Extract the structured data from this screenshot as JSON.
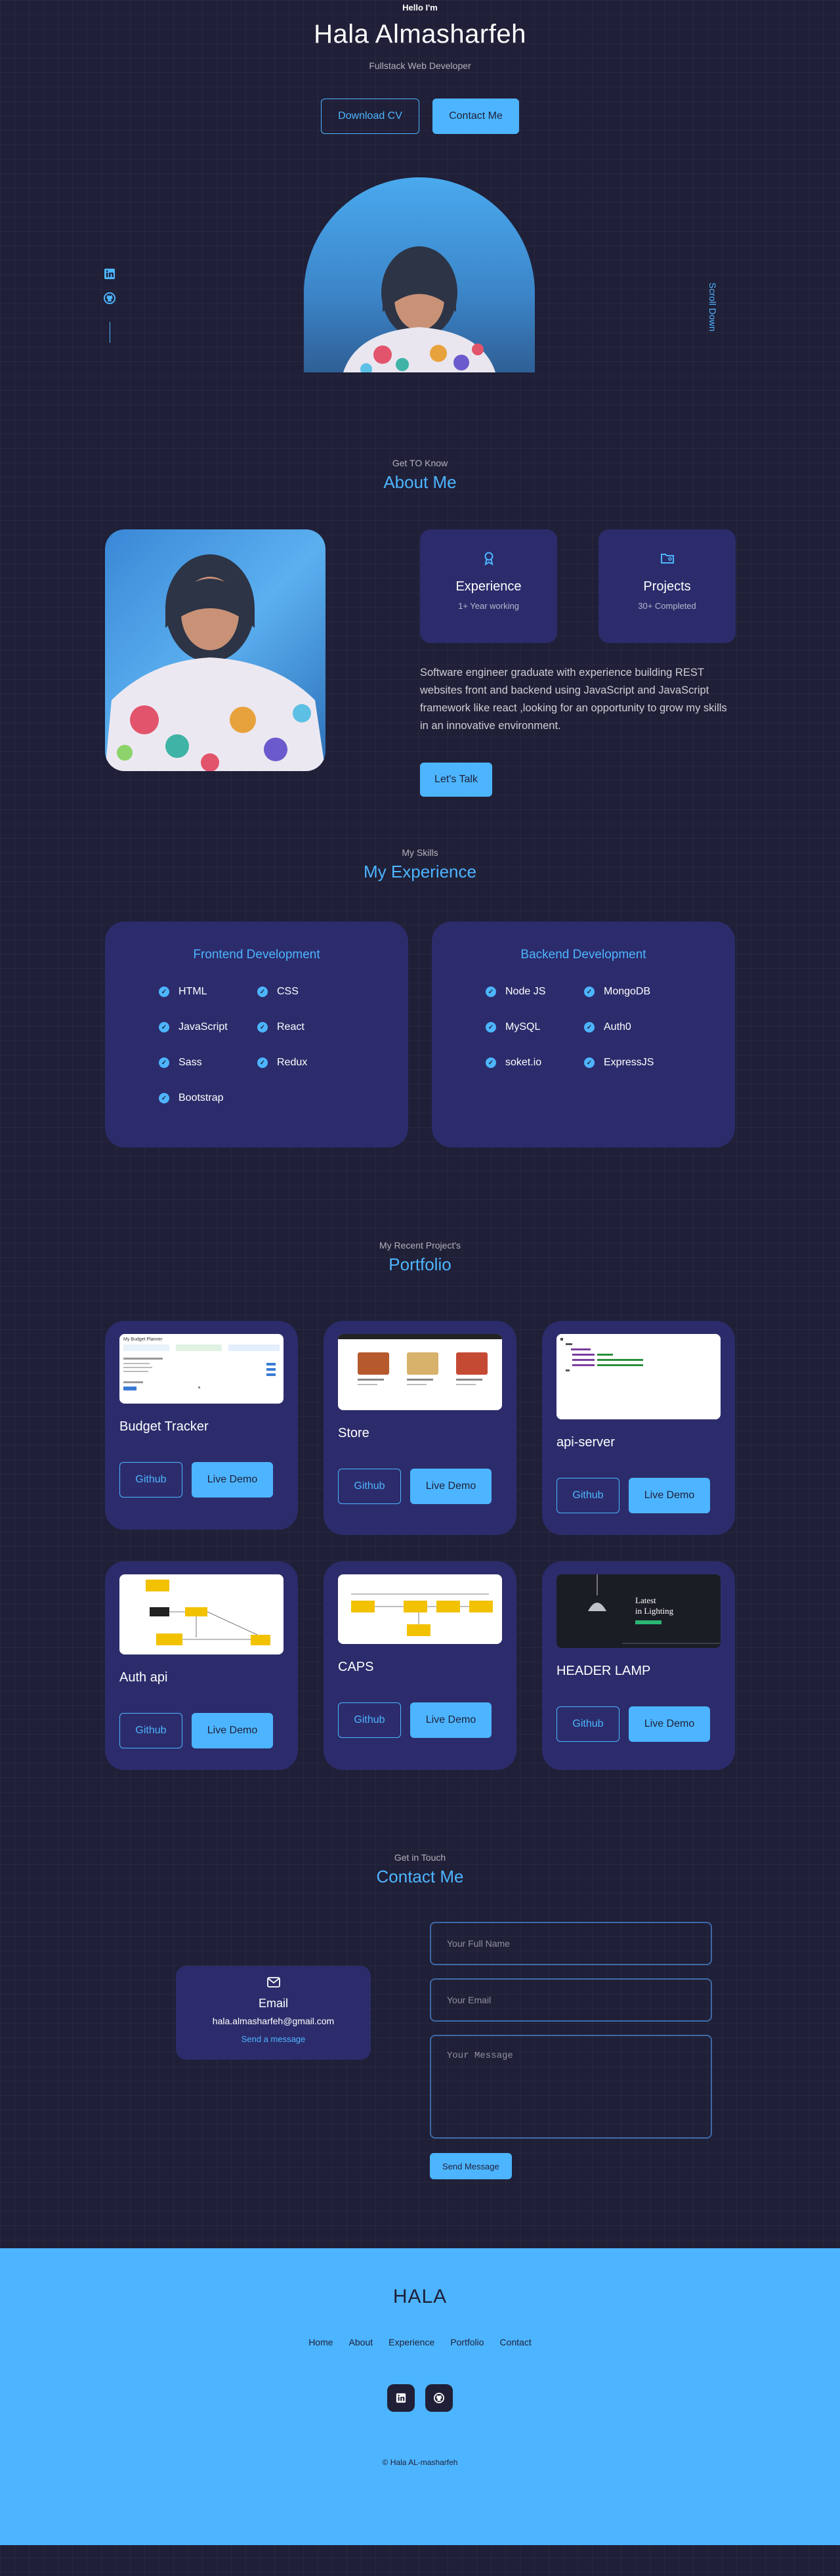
{
  "header": {
    "greeting": "Hello I'm",
    "name": "Hala Almasharfeh",
    "role": "Fullstack Web Developer",
    "download_cv": "Download CV",
    "contact_me": "Contact Me",
    "scroll_down": "Scroll Down"
  },
  "about": {
    "subtitle": "Get TO Know",
    "title": "About Me",
    "cards": [
      {
        "title": "Experience",
        "sub": "1+ Year working",
        "icon": "award-icon"
      },
      {
        "title": "Projects",
        "sub": "30+ Completed",
        "icon": "folder-icon"
      }
    ],
    "text": "Software engineer graduate with experience building REST websites front and backend using JavaScript and JavaScript framework like react ,looking for an opportunity to grow my skills in an innovative environment.",
    "cta": "Let's Talk"
  },
  "experience": {
    "subtitle": "My Skills",
    "title": "My Experience",
    "frontend": {
      "title": "Frontend Development",
      "skills": [
        "HTML",
        "CSS",
        "JavaScript",
        "React",
        "Sass",
        "Redux",
        "Bootstrap"
      ]
    },
    "backend": {
      "title": "Backend Development",
      "skills": [
        "Node JS",
        "MongoDB",
        "MySQL",
        "Auth0",
        "soket.io",
        "ExpressJS"
      ]
    }
  },
  "portfolio": {
    "subtitle": "My Recent Project's",
    "title": "Portfolio",
    "github_label": "Github",
    "demo_label": "Live Demo",
    "projects": [
      {
        "title": "Budget Tracker"
      },
      {
        "title": "Store"
      },
      {
        "title": "api-server"
      },
      {
        "title": "Auth api"
      },
      {
        "title": "CAPS"
      },
      {
        "title": "HEADER LAMP"
      }
    ],
    "thumbs": {
      "budget_heading": "My Budget Planner",
      "lamp_line1": "Latest",
      "lamp_line2": "in Lighting"
    }
  },
  "contact": {
    "subtitle": "Get in Touch",
    "title": "Contact Me",
    "card_title": "Email",
    "email": "hala.almasharfeh@gmail.com",
    "card_link": "Send a message",
    "name_placeholder": "Your Full Name",
    "email_placeholder": "Your Email",
    "message_placeholder": "Your Message",
    "send": "Send Message"
  },
  "footer": {
    "logo": "HALA",
    "nav": [
      "Home",
      "About",
      "Experience",
      "Portfolio",
      "Contact"
    ],
    "copyright": "© Hala AL-masharfeh"
  },
  "colors": {
    "background": "#1f1f38",
    "card": "#2c2c6c",
    "accent": "#4db5ff"
  }
}
